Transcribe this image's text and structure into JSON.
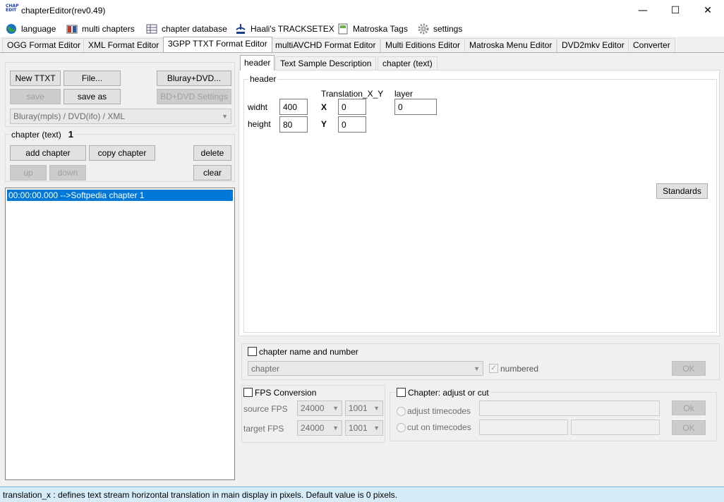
{
  "window": {
    "title": "chapterEditor(rev0.49)",
    "icon_text": "CHAP EDIT",
    "minimize": "—",
    "maximize": "☐",
    "close": "✕"
  },
  "menu": [
    {
      "label": "language",
      "icon": "globe-icon"
    },
    {
      "label": "multi chapters",
      "icon": "book-icon"
    },
    {
      "label": "chapter database",
      "icon": "database-icon"
    },
    {
      "label": "Haali's TRACKSETEX",
      "icon": "tracks-icon"
    },
    {
      "label": "Matroska Tags",
      "icon": "tag-icon"
    },
    {
      "label": "settings",
      "icon": "gear-icon"
    }
  ],
  "main_tabs": [
    "OGG Format Editor",
    "XML Format Editor",
    "3GPP TTXT Format Editor",
    "multiAVCHD Format Editor",
    "Multi Editions Editor",
    "Matroska Menu Editor",
    "DVD2mkv Editor",
    "Converter"
  ],
  "left": {
    "new_ttxt": "New TTXT",
    "file": "File...",
    "bluray_dvd": "Bluray+DVD...",
    "save": "save",
    "save_as": "save as",
    "bd_dvd_settings": "BD+DVD Settings",
    "source_combo": "Bluray(mpls) / DVD(ifo) / XML",
    "chapter_group": "chapter (text)",
    "chapter_count": "1",
    "add_chapter": "add chapter",
    "copy_chapter": "copy chapter",
    "delete": "delete",
    "up": "up",
    "down": "down",
    "clear": "clear",
    "list": [
      "00:00:00.000 -->Softpedia chapter 1"
    ]
  },
  "sub_tabs": [
    "header",
    "Text Sample Description",
    "chapter (text)"
  ],
  "header": {
    "group_label": "header",
    "translation_label": "Translation_X_Y",
    "layer_label": "layer",
    "width_label": "widht",
    "width_value": "400",
    "height_label": "height",
    "height_value": "80",
    "x_label": "X",
    "x_value": "0",
    "y_label": "Y",
    "y_value": "0",
    "layer_value": "0",
    "standards": "Standards"
  },
  "chapter_name": {
    "checkbox_label": "chapter name and number",
    "combo": "chapter",
    "numbered": "numbered",
    "ok": "OK"
  },
  "fps": {
    "checkbox_label": "FPS Conversion",
    "source_label": "source FPS",
    "target_label": "target FPS",
    "source_fps": "24000",
    "source_div": "1001",
    "target_fps": "24000",
    "target_div": "1001"
  },
  "adjust": {
    "checkbox_label": "Chapter: adjust or cut",
    "adjust_label": "adjust timecodes",
    "cut_label": "cut on timecodes",
    "ok1": "Ok",
    "ok2": "OK"
  },
  "status": "translation_x : defines text stream horizontal translation in main display in pixels. Default value is 0 pixels."
}
